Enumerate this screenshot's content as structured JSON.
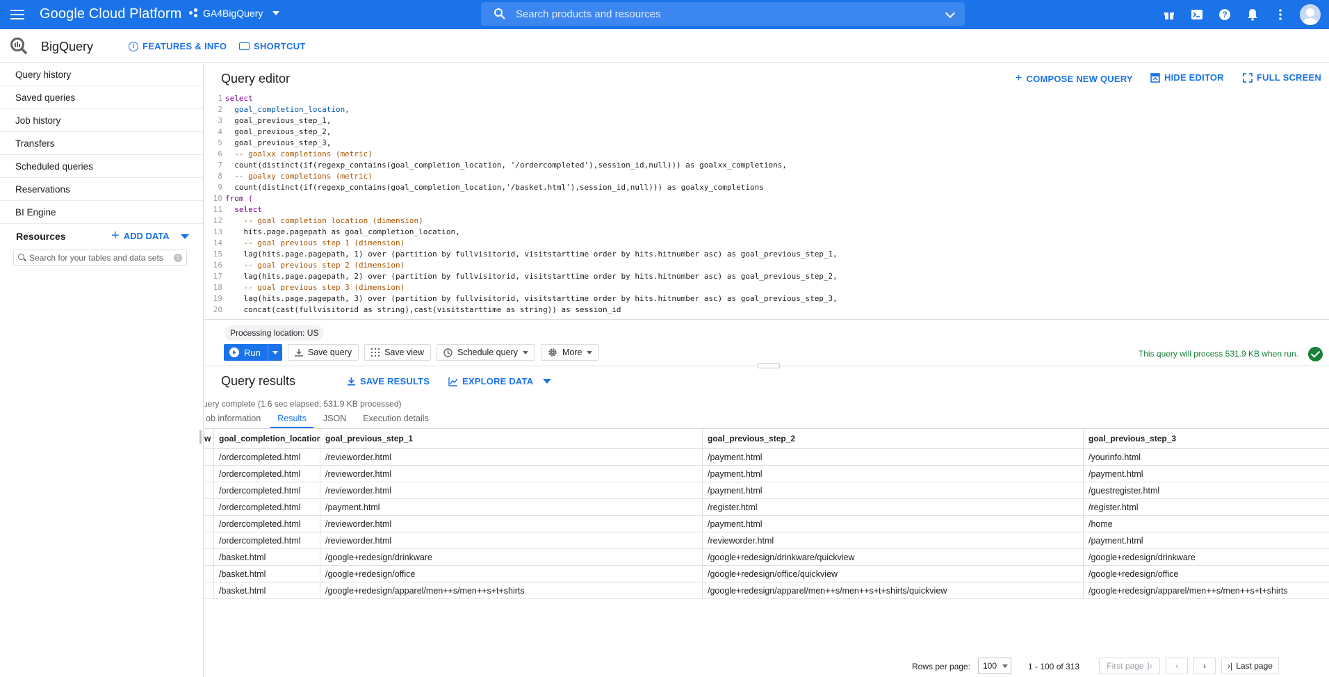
{
  "topbar": {
    "brand": "Google Cloud Platform",
    "project": "GA4BigQuery",
    "search_placeholder": "Search products and resources",
    "icons": [
      "gift-icon",
      "cloud-shell-icon",
      "help-icon",
      "notifications-icon",
      "more-vert-icon",
      "account-avatar-icon"
    ],
    "accent": "#1a73e8"
  },
  "subheader": {
    "product": "BigQuery",
    "features_label": "FEATURES & INFO",
    "shortcut_label": "SHORTCUT"
  },
  "sidebar": {
    "items": [
      {
        "label": "Query history"
      },
      {
        "label": "Saved queries"
      },
      {
        "label": "Job history"
      },
      {
        "label": "Transfers"
      },
      {
        "label": "Scheduled queries"
      },
      {
        "label": "Reservations"
      },
      {
        "label": "BI Engine"
      }
    ],
    "resources_label": "Resources",
    "add_data_label": "ADD DATA",
    "search_placeholder": "Search for your tables and data sets"
  },
  "editor": {
    "title": "Query editor",
    "compose_label": "COMPOSE NEW QUERY",
    "hide_label": "HIDE EDITOR",
    "fullscreen_label": "FULL SCREEN",
    "line_numbers": [
      "1",
      "2",
      "3",
      "4",
      "5",
      "6",
      "7",
      "8",
      "9",
      "10",
      "11",
      "12",
      "13",
      "14",
      "15",
      "16",
      "17",
      "18",
      "19",
      "20"
    ],
    "lines": [
      "select",
      "  goal_completion_location,",
      "  goal_previous_step_1,",
      "  goal_previous_step_2,",
      "  goal_previous_step_3,",
      "  -- goalxx completions (metric)",
      "  count(distinct(if(regexp_contains(goal_completion_location, '/ordercompleted'),session_id,null))) as goalxx_completions,",
      "  -- goalxy completions (metric)",
      "  count(distinct(if(regexp_contains(goal_completion_location,'/basket.html'),session_id,null))) as goalxy_completions",
      "from (",
      "  select",
      "    -- goal completion location (dimension)",
      "    hits.page.pagepath as goal_completion_location,",
      "    -- goal previous step 1 (dimension)",
      "    lag(hits.page.pagepath, 1) over (partition by fullvisitorid, visitstarttime order by hits.hitnumber asc) as goal_previous_step_1,",
      "    -- goal previous step 2 (dimension)",
      "    lag(hits.page.pagepath, 2) over (partition by fullvisitorid, visitstarttime order by hits.hitnumber asc) as goal_previous_step_2,",
      "    -- goal previous step 3 (dimension)",
      "    lag(hits.page.pagepath, 3) over (partition by fullvisitorid, visitstarttime order by hits.hitnumber asc) as goal_previous_step_3,",
      "    concat(cast(fullvisitorid as string),cast(visitstarttime as string)) as session_id"
    ],
    "processing_location": "Processing location: US",
    "run_label": "Run",
    "save_query_label": "Save query",
    "save_view_label": "Save view",
    "schedule_label": "Schedule query",
    "more_label": "More",
    "validator_text": "This query will process 531.9 KB when run.",
    "validator_color": "#188038"
  },
  "results": {
    "title": "Query results",
    "save_label": "SAVE RESULTS",
    "explore_label": "EXPLORE DATA",
    "status": "uery complete (1.6 sec elapsed, 531.9 KB processed)",
    "tabs": [
      "ob information",
      "Results",
      "JSON",
      "Execution details"
    ],
    "active_tab": "Results",
    "row_header_fragment": "w",
    "columns": [
      "goal_completion_location",
      "goal_previous_step_1",
      "goal_previous_step_2",
      "goal_previous_step_3"
    ],
    "rows": [
      [
        "/ordercompleted.html",
        "/revieworder.html",
        "/payment.html",
        "/yourinfo.html"
      ],
      [
        "/ordercompleted.html",
        "/revieworder.html",
        "/payment.html",
        "/payment.html"
      ],
      [
        "/ordercompleted.html",
        "/revieworder.html",
        "/payment.html",
        "/guestregister.html"
      ],
      [
        "/ordercompleted.html",
        "/payment.html",
        "/register.html",
        "/register.html"
      ],
      [
        "/ordercompleted.html",
        "/revieworder.html",
        "/payment.html",
        "/home"
      ],
      [
        "/ordercompleted.html",
        "/revieworder.html",
        "/revieworder.html",
        "/payment.html"
      ],
      [
        "/basket.html",
        "/google+redesign/drinkware",
        "/google+redesign/drinkware/quickview",
        "/google+redesign/drinkware"
      ],
      [
        "/basket.html",
        "/google+redesign/office",
        "/google+redesign/office/quickview",
        "/google+redesign/office"
      ],
      [
        "/basket.html",
        "/google+redesign/apparel/men++s/men++s+t+shirts",
        "/google+redesign/apparel/men++s/men++s+t+shirts/quickview",
        "/google+redesign/apparel/men++s/men++s+t+shirts"
      ]
    ],
    "pagination": {
      "rows_per_page_label": "Rows per page:",
      "rows_per_page": "100",
      "range": "1 - 100 of 313",
      "first_label": "First page",
      "last_label": "Last page"
    }
  }
}
